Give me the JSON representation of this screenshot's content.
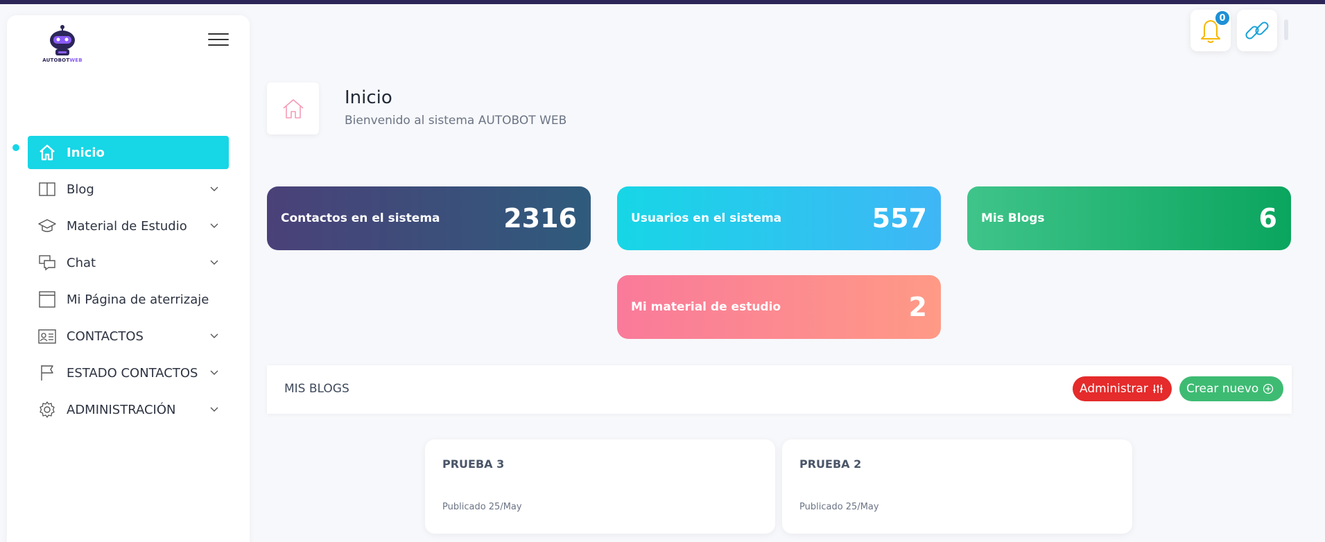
{
  "app": {
    "logo_text": "AUTOBOT",
    "logo_text_accent": "WEB"
  },
  "sidebar": {
    "items": [
      {
        "label": "Inicio",
        "icon": "home-icon",
        "active": true,
        "has_chevron": false
      },
      {
        "label": "Blog",
        "icon": "book-icon",
        "active": false,
        "has_chevron": true
      },
      {
        "label": "Material de Estudio",
        "icon": "graduation-cap-icon",
        "active": false,
        "has_chevron": true
      },
      {
        "label": "Chat",
        "icon": "chat-icon",
        "active": false,
        "has_chevron": true
      },
      {
        "label": "Mi Página de aterrizaje",
        "icon": "browser-window-icon",
        "active": false,
        "has_chevron": false
      },
      {
        "label": "CONTACTOS",
        "icon": "id-card-icon",
        "active": false,
        "has_chevron": true
      },
      {
        "label": "ESTADO CONTACTOS",
        "icon": "flag-icon",
        "active": false,
        "has_chevron": true
      },
      {
        "label": "ADMINISTRACIÓN",
        "icon": "gear-icon",
        "active": false,
        "has_chevron": true
      }
    ]
  },
  "topbar": {
    "notifications_count": "0",
    "notifications_icon": "bell-icon",
    "link_icon": "link-icon"
  },
  "header": {
    "title": "Inicio",
    "subtitle": "Bienvenido al sistema AUTOBOT WEB"
  },
  "stats": [
    {
      "label": "Contactos en el sistema",
      "value": "2316"
    },
    {
      "label": "Usuarios en el sistema",
      "value": "557"
    },
    {
      "label": "Mis Blogs",
      "value": "6"
    },
    {
      "label": "Mi material de estudio",
      "value": "2"
    }
  ],
  "blogs": {
    "title": "MIS BLOGS",
    "admin_label": "Administrar",
    "new_label": "Crear nuevo",
    "posts": [
      {
        "title": "PRUEBA 3",
        "date": "Publicado 25/May"
      },
      {
        "title": "PRUEBA 2",
        "date": "Publicado 25/May"
      }
    ]
  },
  "colors": {
    "accent": "#17d6e6",
    "admin_button": "#e52b2b",
    "new_button": "#3ebb73",
    "badge": "#1e90d6"
  }
}
